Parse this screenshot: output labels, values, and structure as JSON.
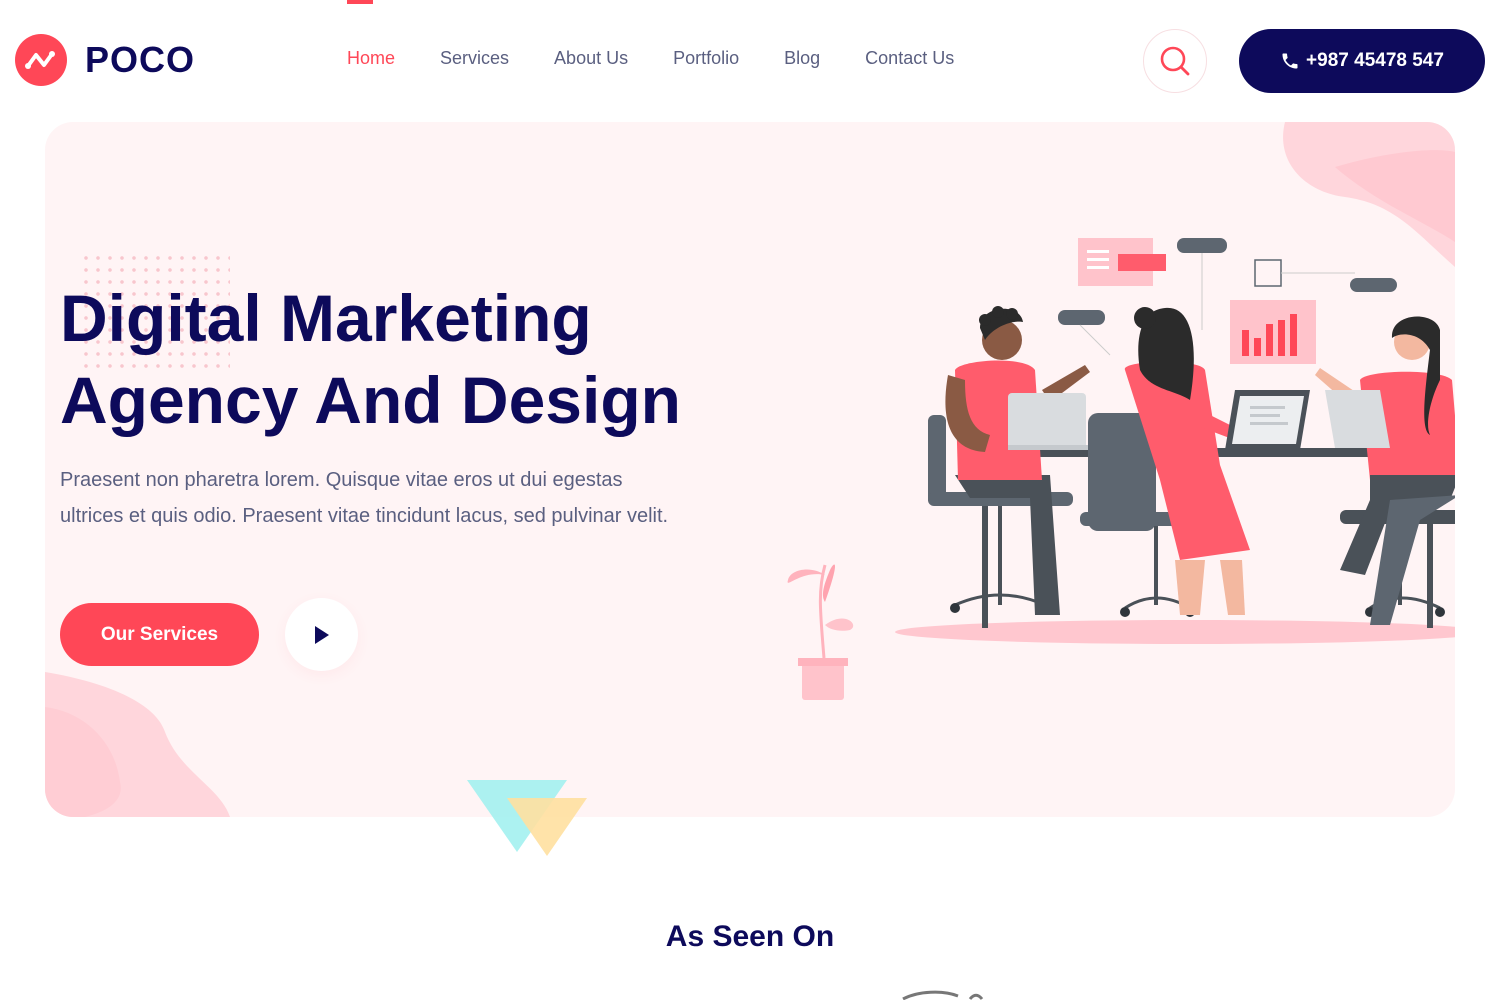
{
  "brand": {
    "name": "POCO",
    "accent": "#ff4757",
    "navy": "#0d0a5b"
  },
  "nav": {
    "items": [
      {
        "label": "Home",
        "active": true
      },
      {
        "label": "Services",
        "active": false
      },
      {
        "label": "About Us",
        "active": false
      },
      {
        "label": "Portfolio",
        "active": false
      },
      {
        "label": "Blog",
        "active": false
      },
      {
        "label": "Contact Us",
        "active": false
      }
    ]
  },
  "header": {
    "search_icon": "search-icon",
    "phone_icon": "phone-icon",
    "phone_label": "+987 45478 547"
  },
  "hero": {
    "title_line1": "Digital Marketing",
    "title_line2": "Agency And Design",
    "description": "Praesent non pharetra lorem. Quisque vitae eros ut dui egestas ultrices et quis odio. Praesent vitae tincidunt lacus, sed pulvinar velit.",
    "cta_label": "Our Services",
    "play_icon": "play-icon"
  },
  "seen_on": {
    "heading": "As Seen On"
  }
}
